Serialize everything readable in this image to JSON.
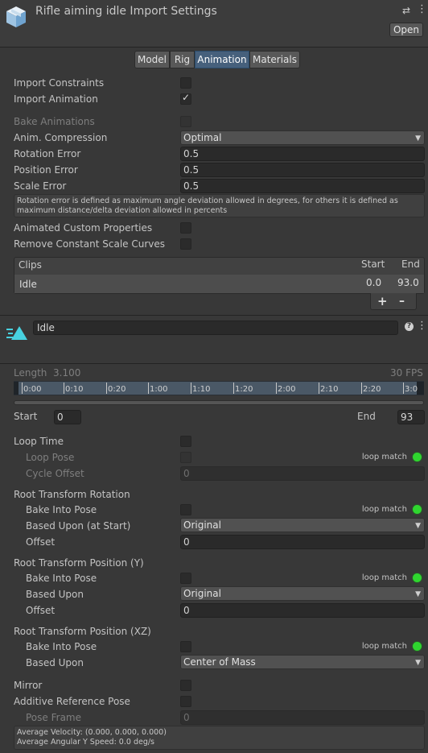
{
  "header": {
    "title": "Rifle aiming idle Import Settings",
    "open_label": "Open",
    "settings_glyph": "⇄",
    "menu_glyph": "⋮",
    "icon": "package-cube-icon"
  },
  "tabs": [
    "Model",
    "Rig",
    "Animation",
    "Materials"
  ],
  "active_tab": "Animation",
  "settings": {
    "import_constraints": "Import Constraints",
    "import_animation": "Import Animation",
    "bake_animations": "Bake Animations",
    "anim_compression": "Anim. Compression",
    "anim_compression_value": "Optimal",
    "rotation_error": "Rotation Error",
    "rotation_error_value": "0.5",
    "position_error": "Position Error",
    "position_error_value": "0.5",
    "scale_error": "Scale Error",
    "scale_error_value": "0.5",
    "help_text": "Rotation error is defined as maximum angle deviation allowed in degrees, for others it is defined as maximum distance/delta deviation allowed in percents",
    "animated_custom_properties": "Animated Custom Properties",
    "remove_constant_scale_curves": "Remove Constant Scale Curves",
    "check_mark": "✓"
  },
  "clips": {
    "header": "Clips",
    "start_header": "Start",
    "end_header": "End",
    "rows": [
      {
        "name": "Idle",
        "start": "0.0",
        "end": "93.0"
      }
    ],
    "add": "+",
    "remove": "–"
  },
  "clip": {
    "name": "Idle",
    "help_glyph": "?",
    "menu_glyph": "⋮",
    "icon": "animation-clip-icon",
    "length_label": "Length",
    "length_value": "3.100",
    "fps": "30 FPS",
    "timeline_ticks": [
      "0:00",
      "0:10",
      "0:20",
      "1:00",
      "1:10",
      "1:20",
      "2:00",
      "2:10",
      "2:20",
      "3:0"
    ],
    "start_label": "Start",
    "start_value": "0",
    "end_label": "End",
    "end_value": "93"
  },
  "loop": {
    "loop_time": "Loop Time",
    "loop_pose": "Loop Pose",
    "loop_match": "loop match",
    "cycle_offset": "Cycle Offset",
    "cycle_offset_value": "0"
  },
  "rtr": {
    "title": "Root Transform Rotation",
    "bake": "Bake Into Pose",
    "loop_match": "loop match",
    "based_upon": "Based Upon (at Start)",
    "based_upon_value": "Original",
    "offset": "Offset",
    "offset_value": "0"
  },
  "rty": {
    "title": "Root Transform Position (Y)",
    "bake": "Bake Into Pose",
    "loop_match": "loop match",
    "based_upon": "Based Upon",
    "based_upon_value": "Original",
    "offset": "Offset",
    "offset_value": "0"
  },
  "rtxz": {
    "title": "Root Transform Position (XZ)",
    "bake": "Bake Into Pose",
    "loop_match": "loop match",
    "based_upon": "Based Upon",
    "based_upon_value": "Center of Mass"
  },
  "misc": {
    "mirror": "Mirror",
    "additive_reference_pose": "Additive Reference Pose",
    "pose_frame": "Pose Frame",
    "pose_frame_value": "0",
    "avg_velocity": "Average Velocity: (0.000, 0.000, 0.000)",
    "avg_angular": "Average Angular Y Speed: 0.0 deg/s"
  },
  "colors": {
    "background": "#383838",
    "header": "#3c3c3c",
    "active_tab": "#46607c",
    "loop_match_dot": "#2fd62f"
  }
}
